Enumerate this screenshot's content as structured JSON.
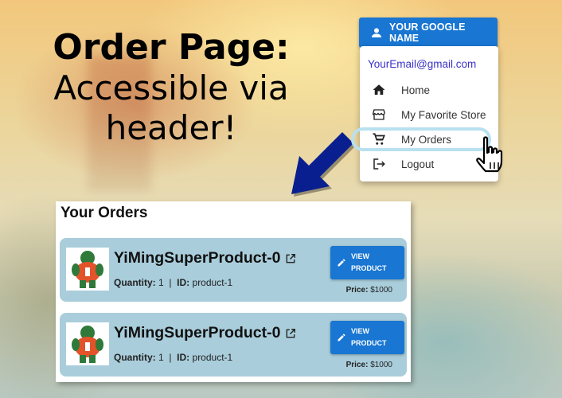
{
  "promo": {
    "title": "Order Page:",
    "line1": "Accessible via",
    "line2": "header!"
  },
  "account": {
    "button_label": "YOUR GOOGLE NAME",
    "email": "YourEmail@gmail.com",
    "menu": [
      {
        "label": "Home",
        "icon": "home-icon"
      },
      {
        "label": "My Favorite Store",
        "icon": "store-icon"
      },
      {
        "label": "My Orders",
        "icon": "cart-icon"
      },
      {
        "label": "Logout",
        "icon": "logout-icon"
      }
    ]
  },
  "orders": {
    "title": "Your Orders",
    "items": [
      {
        "name": "YiMingSuperProduct-0",
        "quantity_label": "Quantity:",
        "quantity": "1",
        "sep": "|",
        "id_label": "ID:",
        "id": "product-1",
        "button_line1": "VIEW",
        "button_line2": "PRODUCT",
        "price_label": "Price:",
        "price": "$1000"
      },
      {
        "name": "YiMingSuperProduct-0",
        "quantity_label": "Quantity:",
        "quantity": "1",
        "sep": "|",
        "id_label": "ID:",
        "id": "product-1",
        "button_line1": "VIEW",
        "button_line2": "PRODUCT",
        "price_label": "Price:",
        "price": "$1000"
      }
    ]
  },
  "colors": {
    "primary": "#1976d2",
    "card": "#a9cddb",
    "arrow": "#0a1f8f",
    "email": "#3a32c9"
  }
}
